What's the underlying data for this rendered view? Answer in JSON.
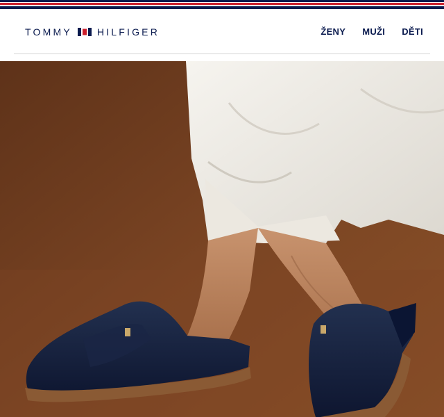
{
  "brand": {
    "name_left": "TOMMY",
    "name_right": "HILFIGER",
    "colors": {
      "navy": "#0b1b4f",
      "red": "#cc1e2b"
    }
  },
  "nav": {
    "items": [
      {
        "label": "ŽENY"
      },
      {
        "label": "MUŽI"
      },
      {
        "label": "DĚTI"
      }
    ]
  },
  "hero": {
    "image": "woman-wearing-navy-leather-mules-with-white-trousers",
    "background_color": "#6b3a1e"
  }
}
